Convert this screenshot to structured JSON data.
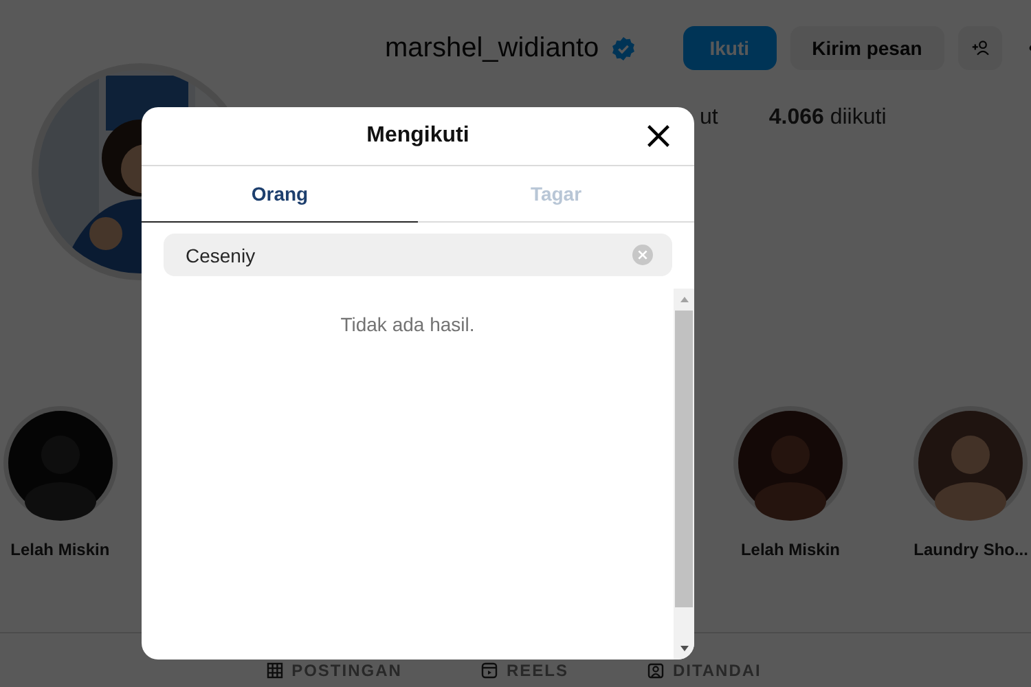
{
  "profile": {
    "username": "marshel_widianto",
    "buttons": [
      {
        "label": "Ikuti",
        "kind": "primary"
      },
      {
        "label": "Kirim pesan",
        "kind": "secondary"
      }
    ],
    "stats": [
      {
        "text": "ut"
      },
      {
        "text": "**4.066** diikuti"
      }
    ]
  },
  "highlights": [
    {
      "label": "Lelah Miskin"
    },
    {
      "label": "Lelah Miskin"
    },
    {
      "label": "Laundry Sho..."
    }
  ],
  "profile_tabs": [
    {
      "label": "POSTINGAN"
    },
    {
      "label": "REELS"
    },
    {
      "label": "DITANDAI"
    }
  ],
  "modal": {
    "title": "Mengikuti",
    "tabs": [
      {
        "label": "Orang",
        "selected": true
      },
      {
        "label": "Tagar",
        "selected": false
      }
    ],
    "search": {
      "value": "Ceseniy"
    },
    "empty_message": "Tidak ada hasil."
  }
}
